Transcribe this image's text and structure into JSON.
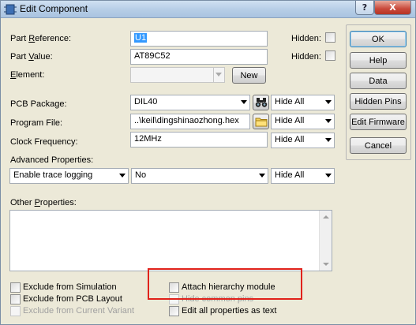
{
  "window": {
    "title": "Edit Component",
    "help_glyph": "?",
    "close_glyph": "X"
  },
  "fields": {
    "part_reference": {
      "label_pre": "Part ",
      "label_u": "R",
      "label_post": "eference:",
      "value": "U1"
    },
    "part_value": {
      "label_pre": "Part ",
      "label_u": "V",
      "label_post": "alue:",
      "value": "AT89C52"
    },
    "element": {
      "label_u": "E",
      "label_post": "lement:",
      "value": ""
    },
    "hidden_label_1": "Hidden:",
    "hidden_label_2": "Hidden:",
    "new_button": "New",
    "pcb_package": {
      "label": "PCB Package:",
      "value": "DIL40",
      "visibility": "Hide All"
    },
    "program_file": {
      "label": "Program File:",
      "value": "..\\keil\\dingshinaozhong.hex",
      "visibility": "Hide All"
    },
    "clock_frequency": {
      "label": "Clock Frequency:",
      "value": "12MHz",
      "visibility": "Hide All"
    },
    "advanced_properties": {
      "label": "Advanced Properties:",
      "property": "Enable trace logging",
      "value": "No",
      "visibility": "Hide All"
    },
    "other_properties": {
      "label_pre": "Other ",
      "label_u": "P",
      "label_post": "roperties:"
    }
  },
  "checkboxes": {
    "exclude_simulation": "Exclude from Simulation",
    "exclude_pcb": "Exclude from PCB Layout",
    "exclude_variant": "Exclude from Current Variant",
    "attach_hierarchy": "Attach hierarchy module",
    "hide_common_pins": "Hide common pins",
    "edit_all_props": "Edit all properties as text"
  },
  "side_buttons": {
    "ok": "OK",
    "help": "Help",
    "data": "Data",
    "hidden_pins": "Hidden Pins",
    "edit_firmware": "Edit Firmware",
    "cancel": "Cancel"
  },
  "icons": {
    "app": "component-icon",
    "package_browse": "binoculars-icon",
    "file_browse": "folder-icon"
  },
  "colors": {
    "highlight_box": "#e0221b",
    "selection": "#3399ff"
  }
}
